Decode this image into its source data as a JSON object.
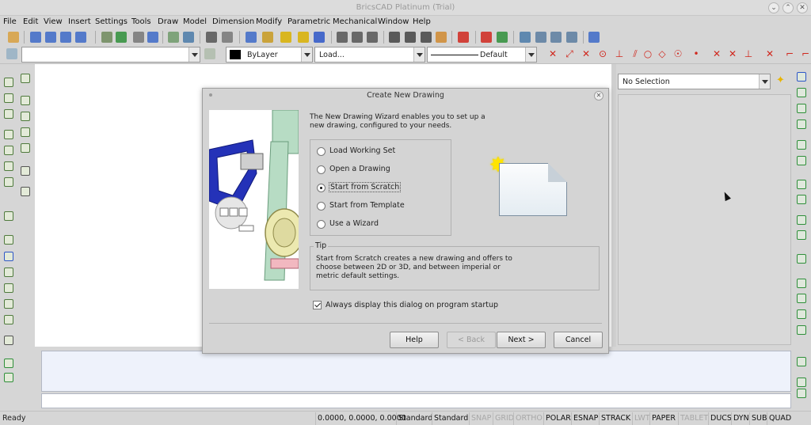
{
  "window": {
    "title": "BricsCAD Platinum (Trial)"
  },
  "menu": [
    "File",
    "Edit",
    "View",
    "Insert",
    "Settings",
    "Tools",
    "Draw",
    "Model",
    "Dimension",
    "Modify",
    "Parametric",
    "Mechanical",
    "Window",
    "Help"
  ],
  "toolbar": {
    "color_value": "ByLayer",
    "linetype_value": "Load...",
    "lineweight_value": "Default"
  },
  "properties_panel": {
    "selection_value": "No Selection"
  },
  "dialog": {
    "title": "Create New Drawing",
    "intro": "The New Drawing Wizard enables you to set up a new drawing, configured to your needs.",
    "options": [
      {
        "label": "Load Working Set",
        "selected": false
      },
      {
        "label": "Open a Drawing",
        "selected": false
      },
      {
        "label": "Start from Scratch",
        "selected": true
      },
      {
        "label": "Start from Template",
        "selected": false
      },
      {
        "label": "Use a Wizard",
        "selected": false
      }
    ],
    "tip_label": "Tip",
    "tip_text": "Start from Scratch creates a new drawing and offers to choose between 2D or 3D, and between imperial or metric default settings.",
    "checkbox_label": "Always display this dialog on program startup",
    "checkbox_checked": true,
    "buttons": {
      "help": "Help",
      "back": "< Back",
      "next": "Next >",
      "cancel": "Cancel"
    }
  },
  "statusbar": {
    "ready": "Ready",
    "coords": "0.0000, 0.0000, 0.0000",
    "style1": "Standard",
    "style2": "Standard",
    "toggles": [
      {
        "label": "SNAP",
        "on": false
      },
      {
        "label": "GRID",
        "on": false
      },
      {
        "label": "ORTHO",
        "on": false
      },
      {
        "label": "POLAR",
        "on": true
      },
      {
        "label": "ESNAP",
        "on": true
      },
      {
        "label": "STRACK",
        "on": true
      },
      {
        "label": "LWT",
        "on": false
      },
      {
        "label": "PAPER",
        "on": true
      },
      {
        "label": "TABLET",
        "on": false
      },
      {
        "label": "DUCS",
        "on": true
      },
      {
        "label": "DYN",
        "on": true
      },
      {
        "label": "SUB",
        "on": true
      },
      {
        "label": "QUAD",
        "on": true
      }
    ]
  },
  "colors": {
    "accent_red": "#d0281e",
    "accent_green": "#2f8f3a",
    "accent_blue": "#2d56c8",
    "illustration_blue": "#2432b8",
    "illustration_green": "#b7dcc4",
    "illustration_yellow": "#ece9b0"
  },
  "icons": [
    "search-icon",
    "gear-icon",
    "undo-icon",
    "redo-icon",
    "print-icon",
    "save-icon",
    "open-folder-icon",
    "new-file-icon",
    "cut-icon",
    "copy-icon",
    "paste-icon",
    "line-icon",
    "arc-icon",
    "circle-icon",
    "text-icon",
    "move-icon",
    "hatch-icon"
  ]
}
